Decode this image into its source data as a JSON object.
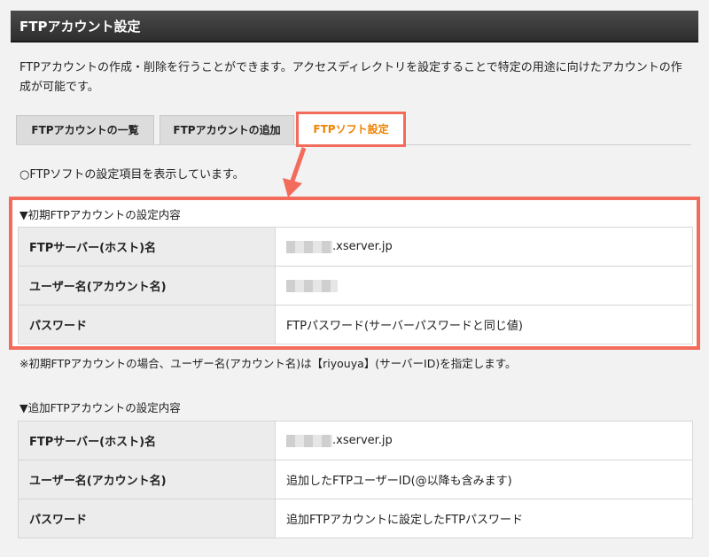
{
  "header": {
    "title": "FTPアカウント設定"
  },
  "description": "FTPアカウントの作成・削除を行うことができます。アクセスディレクトリを設定することで特定の用途に向けたアカウントの作成が可能です。",
  "tabs": [
    {
      "label": "FTPアカウントの一覧",
      "active": false
    },
    {
      "label": "FTPアカウントの追加",
      "active": false
    },
    {
      "label": "FTPソフト設定",
      "active": true
    }
  ],
  "info_text": "○FTPソフトの設定項目を表示しています。",
  "initial_section": {
    "title": "▼初期FTPアカウントの設定内容",
    "rows": [
      {
        "key": "FTPサーバー(ホスト)名",
        "value": ".xserver.jp"
      },
      {
        "key": "ユーザー名(アカウント名)",
        "value": ""
      },
      {
        "key": "パスワード",
        "value": "FTPパスワード(サーバーパスワードと同じ値)"
      }
    ],
    "note": "※初期FTPアカウントの場合、ユーザー名(アカウント名)は【riyouya】(サーバーID)を指定します。"
  },
  "additional_section": {
    "title": "▼追加FTPアカウントの設定内容",
    "rows": [
      {
        "key": "FTPサーバー(ホスト)名",
        "value": ".xserver.jp"
      },
      {
        "key": "ユーザー名(アカウント名)",
        "value": "追加したFTPユーザーID(@以降も含みます)"
      },
      {
        "key": "パスワード",
        "value": "追加FTPアカウントに設定したFTPパスワード"
      }
    ]
  },
  "colors": {
    "highlight": "#f26b5b",
    "active_tab_text": "#f08300",
    "header_bg": "#333333"
  }
}
